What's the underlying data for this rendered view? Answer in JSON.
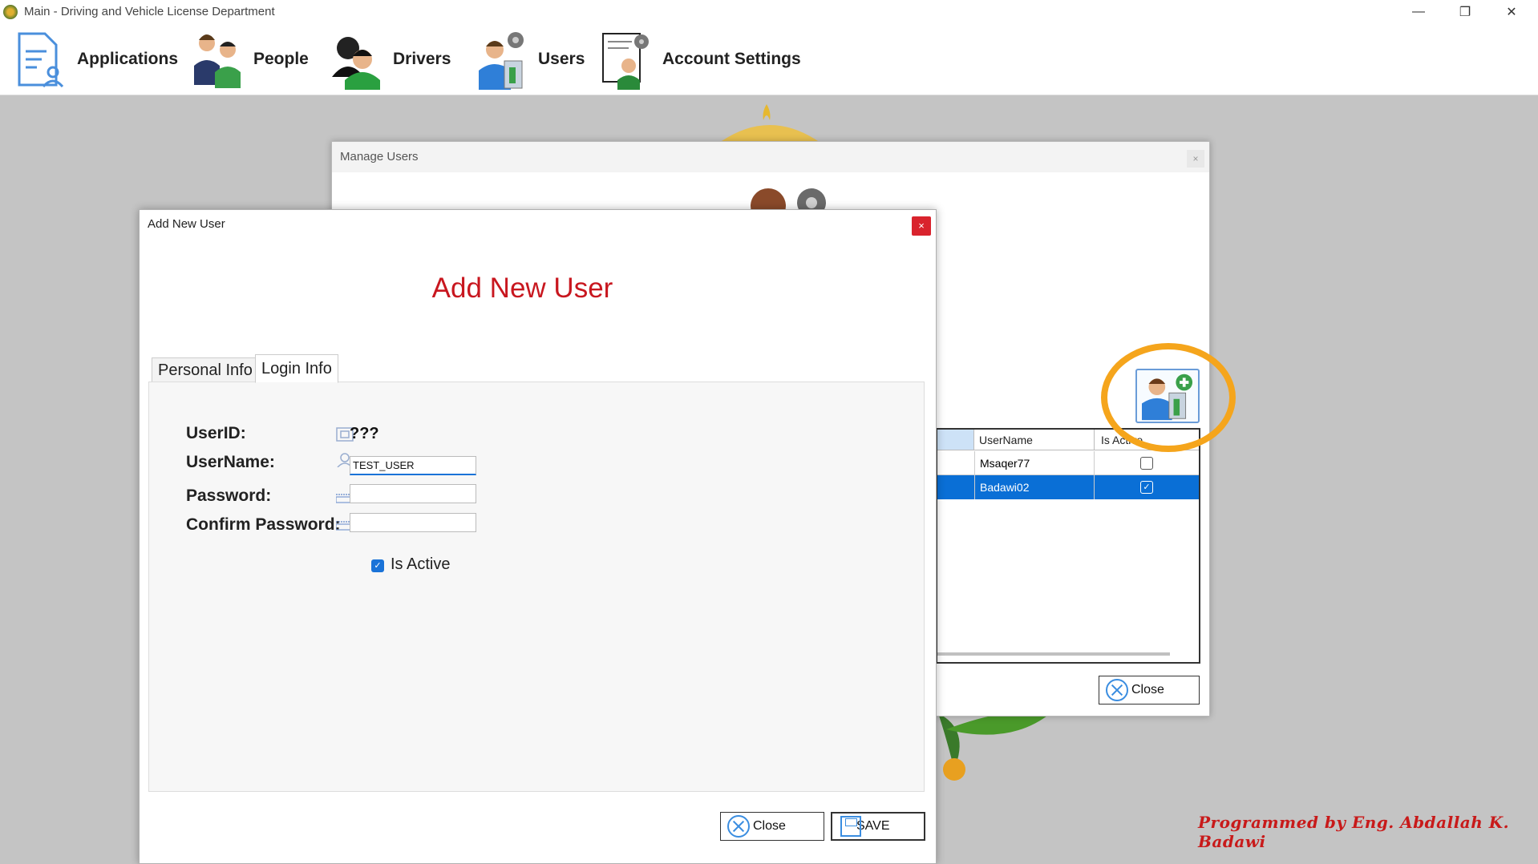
{
  "window": {
    "title": "Main - Driving and Vehicle License Department",
    "controls": [
      "minimize",
      "restore",
      "close"
    ]
  },
  "menu": {
    "items": [
      {
        "label": "Applications",
        "icon": "applications-icon"
      },
      {
        "label": "People",
        "icon": "people-icon"
      },
      {
        "label": "Drivers",
        "icon": "drivers-icon"
      },
      {
        "label": "Users",
        "icon": "users-icon"
      },
      {
        "label": "Account Settings",
        "icon": "account-settings-icon"
      }
    ]
  },
  "manage_users": {
    "title": "Manage Users",
    "close_glyph": "×",
    "columns": [
      "UserName",
      "Is Active"
    ],
    "rows": [
      {
        "username": "Msaqer77",
        "is_active": false,
        "selected": false
      },
      {
        "username": "Badawi02",
        "is_active": true,
        "selected": true
      }
    ],
    "close_label": "Close",
    "highlight_color": "#f5a51c"
  },
  "add_user": {
    "title": "Add New User",
    "heading": "Add New User",
    "close_glyph": "×",
    "tabs": [
      {
        "label": "Personal Info",
        "active": false
      },
      {
        "label": "Login Info",
        "active": true
      }
    ],
    "fields": {
      "user_id_label": "UserID:",
      "user_id_value": "???",
      "username_label": "UserName:",
      "username_value": "TEST_USER",
      "password_label": "Password:",
      "password_value": "",
      "confirm_label": "Confirm Password:",
      "confirm_value": ""
    },
    "is_active_label": "Is Active",
    "is_active_checked": true,
    "close_label": "Close",
    "save_label": "SAVE",
    "heading_color": "#c8171f"
  },
  "footer": {
    "signature": "Programmed by Eng. Abdallah K. Badawi"
  }
}
